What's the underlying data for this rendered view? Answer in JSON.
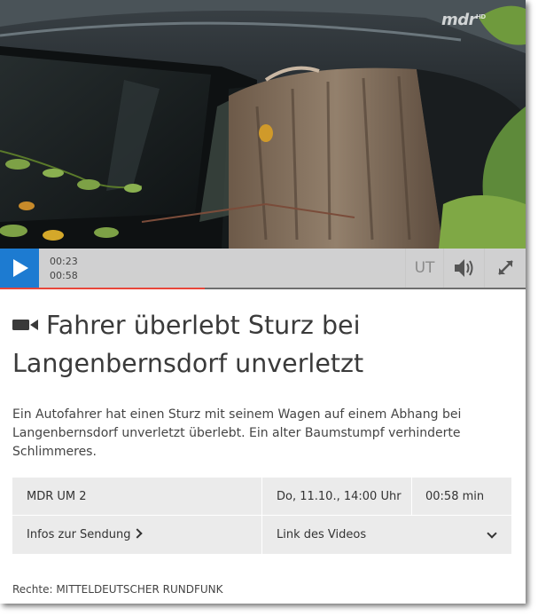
{
  "video": {
    "logo": "mdr",
    "logo_sup": "HD",
    "current_time": "00:23",
    "total_time": "00:58",
    "progress": 0.39,
    "subtitle_label": "UT",
    "accent": "#1d7bd1",
    "progress_color": "#e8463a"
  },
  "article": {
    "icon": "video-camera-icon",
    "title": "Fahrer überlebt Sturz bei Langenbernsdorf unverletzt",
    "description": "Ein Autofahrer hat einen Sturz mit seinem Wagen auf einem Abhang bei Langenbernsdorf unverletzt überlebt. Ein alter Baumstumpf verhinderte Schlimmeres."
  },
  "info": {
    "program": "MDR UM 2",
    "date": "Do, 11.10., 14:00 Uhr",
    "duration": "00:58 min",
    "more_info_link": "Infos zur Sendung",
    "video_link": "Link des Videos"
  },
  "footer": {
    "rights": "Rechte: MITTELDEUTSCHER RUNDFUNK"
  }
}
